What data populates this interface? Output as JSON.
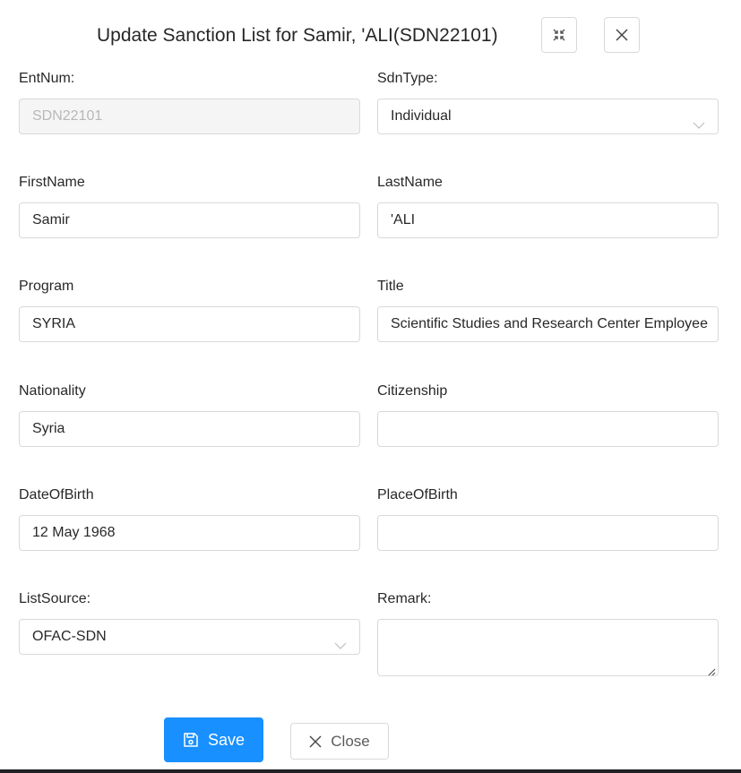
{
  "dialog": {
    "title": "Update Sanction List for Samir, 'ALI(SDN22101)",
    "fullscreen_icon": "fullscreen-icon",
    "close_icon": "close-icon"
  },
  "form": {
    "entnum": {
      "label": "EntNum:",
      "value": "SDN22101",
      "disabled": true
    },
    "sdntype": {
      "label": "SdnType:",
      "value": "Individual",
      "icon": "chevron-down-icon"
    },
    "firstname": {
      "label": "FirstName",
      "value": "Samir"
    },
    "lastname": {
      "label": "LastName",
      "value": "'ALI"
    },
    "program": {
      "label": "Program",
      "value": "SYRIA"
    },
    "title": {
      "label": "Title",
      "value": "Scientific Studies and Research Center Employee"
    },
    "nationality": {
      "label": "Nationality",
      "value": "Syria"
    },
    "citizenship": {
      "label": "Citizenship",
      "value": ""
    },
    "dateofbirth": {
      "label": "DateOfBirth",
      "value": "12 May 1968"
    },
    "placeofbirth": {
      "label": "PlaceOfBirth",
      "value": ""
    },
    "listsource": {
      "label": "ListSource:",
      "value": "OFAC-SDN",
      "icon": "chevron-down-icon"
    },
    "remark": {
      "label": "Remark:",
      "value": ""
    }
  },
  "footer": {
    "save_label": "Save",
    "save_icon": "save-icon",
    "close_label": "Close",
    "close_icon": "close-icon"
  },
  "colors": {
    "primary": "#1890ff",
    "border": "#d9d9d9",
    "disabled_bg": "#f5f5f5"
  }
}
